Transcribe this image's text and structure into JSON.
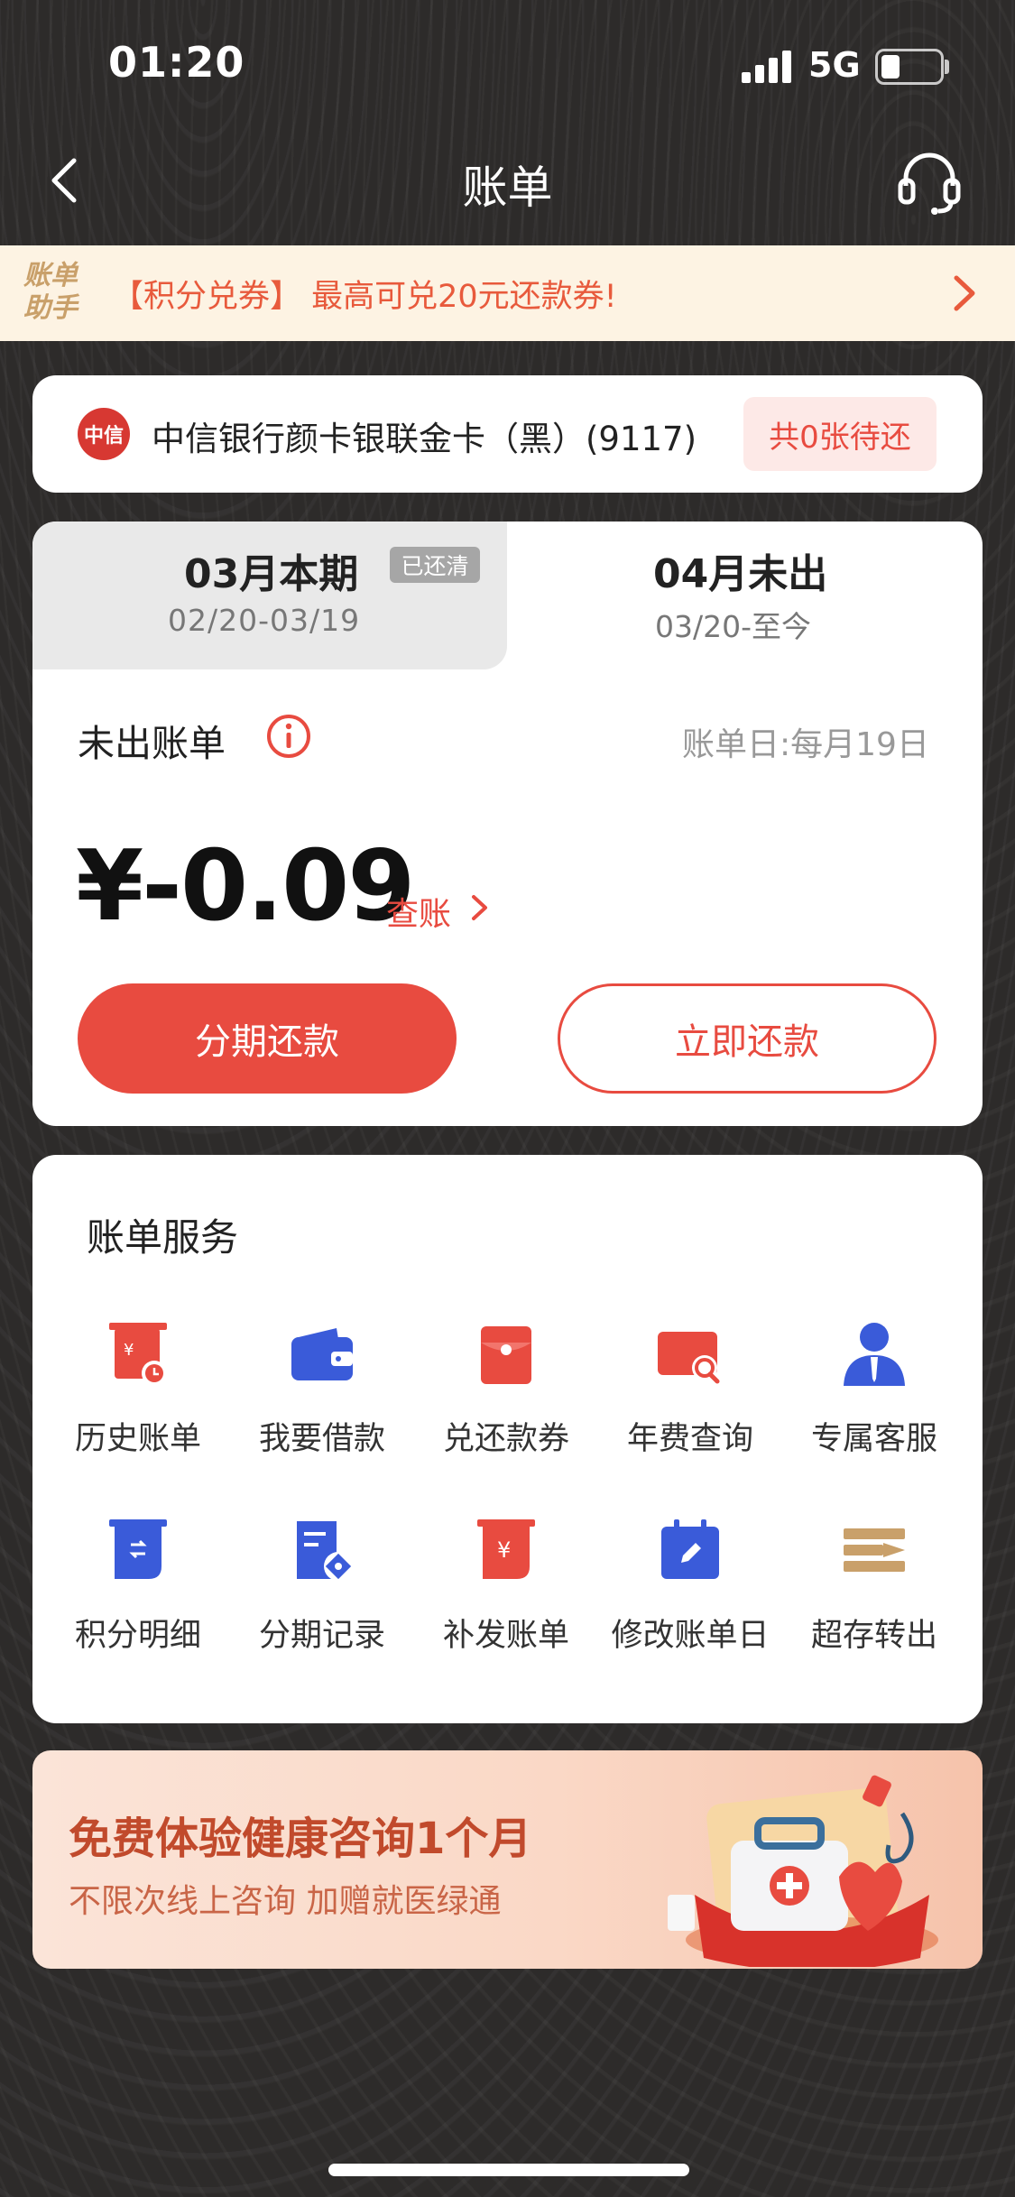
{
  "status_bar": {
    "time": "01:20",
    "network": "5G"
  },
  "nav": {
    "title": "账单",
    "back_icon": "chevron-left-icon",
    "service_icon": "headset-icon"
  },
  "promo": {
    "logo_line1": "账单",
    "logo_line2": "助手",
    "text": "【积分兑券】 最高可兑20元还款券!"
  },
  "card": {
    "bank_logo_text": "中信",
    "name": "中信银行颜卡银联金卡（黑）(9117)",
    "pending": "共0张待还"
  },
  "bill": {
    "tabs": [
      {
        "title": "03月本期",
        "badge": "已还清",
        "range": "02/20-03/19"
      },
      {
        "title": "04月未出",
        "range": "03/20-至今"
      }
    ],
    "unbilled_label": "未出账单",
    "billing_day": "账单日:每月19日",
    "amount": "¥-0.09",
    "check_link": "查账",
    "installment_button": "分期还款",
    "repay_button": "立即还款"
  },
  "services": {
    "title": "账单服务",
    "items": [
      {
        "label": "历史账单",
        "icon": "history-bill-icon"
      },
      {
        "label": "我要借款",
        "icon": "wallet-icon"
      },
      {
        "label": "兑还款券",
        "icon": "red-envelope-icon"
      },
      {
        "label": "年费查询",
        "icon": "card-search-icon"
      },
      {
        "label": "专属客服",
        "icon": "agent-icon"
      },
      {
        "label": "积分明细",
        "icon": "points-icon"
      },
      {
        "label": "分期记录",
        "icon": "installment-record-icon"
      },
      {
        "label": "补发账单",
        "icon": "reissue-bill-icon"
      },
      {
        "label": "修改账单日",
        "icon": "calendar-edit-icon"
      },
      {
        "label": "超存转出",
        "icon": "transfer-out-icon"
      }
    ]
  },
  "health_banner": {
    "title": "免费体验健康咨询1个月",
    "subtitle": "不限次线上咨询 加赠就医绿通"
  },
  "colors": {
    "accent_red": "#e84b40",
    "icon_blue": "#3a5bd9",
    "gold": "#c9a06a"
  }
}
